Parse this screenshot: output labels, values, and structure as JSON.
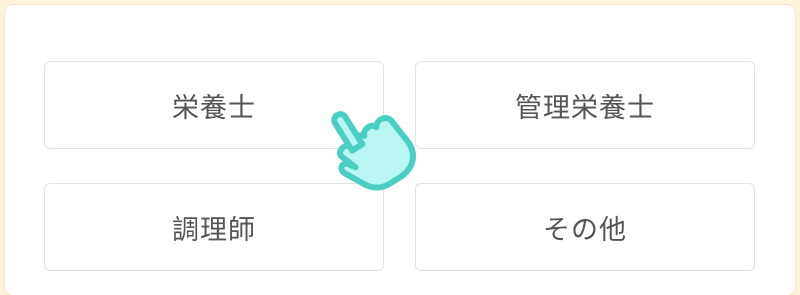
{
  "options": [
    {
      "label": "栄養士"
    },
    {
      "label": "管理栄養士"
    },
    {
      "label": "調理師"
    },
    {
      "label": "その他"
    }
  ],
  "pointer_icon": "pointing-hand-icon",
  "colors": {
    "page_background": "#fdf2dc",
    "button_border": "#e2e2e2",
    "text": "#555555",
    "hand_fill": "#b9f6f2",
    "hand_stroke": "#4ccfc2"
  }
}
